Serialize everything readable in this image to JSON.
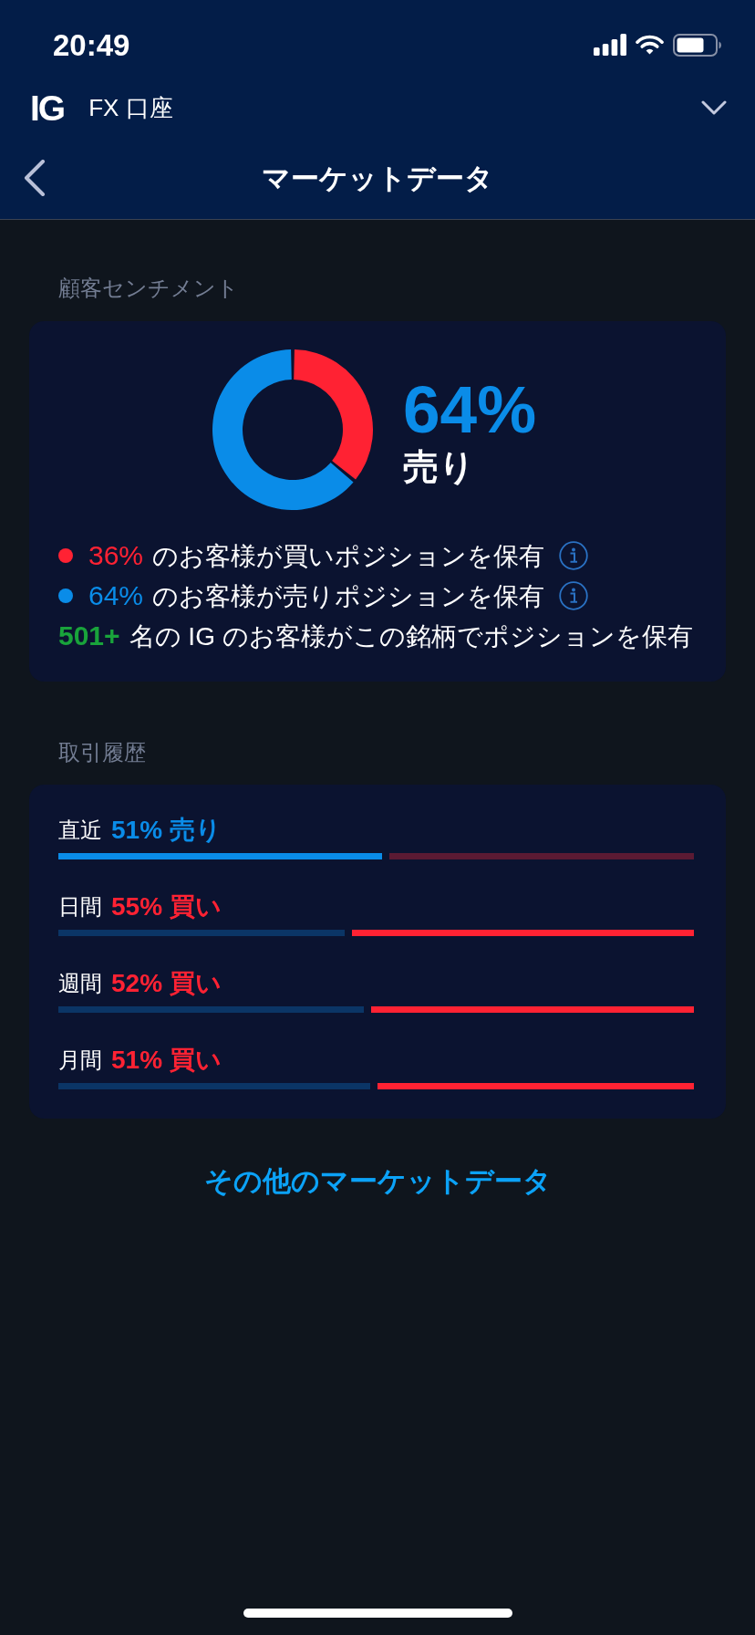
{
  "status_bar": {
    "time": "20:49"
  },
  "account_bar": {
    "logo": "IG",
    "account": "FX 口座"
  },
  "nav_bar": {
    "title": "マーケットデータ"
  },
  "sentiment": {
    "label": "顧客センチメント",
    "chart_data": {
      "type": "donut",
      "values": [
        36,
        64
      ]
    },
    "headline": {
      "value": "64%",
      "side": "売り",
      "kind": "sell"
    },
    "legend": [
      {
        "kind": "share",
        "color": "#ff2233",
        "percent": "36%",
        "text": "のお客様が買いポジションを保有"
      },
      {
        "kind": "share",
        "color": "#0a8ce8",
        "percent": "64%",
        "text": "のお客様が売りポジションを保有"
      },
      {
        "kind": "count",
        "count": "501+",
        "text": "名の IG のお客様がこの銘柄でポジションを保有"
      }
    ]
  },
  "history": {
    "label": "取引履歴",
    "rows": [
      {
        "period": "直近",
        "reading": "51% 売り",
        "kind": "sell",
        "level": 0.51
      },
      {
        "period": "日間",
        "reading": "55% 買い",
        "kind": "buy",
        "level": 0.45
      },
      {
        "period": "週間",
        "reading": "52% 買い",
        "kind": "buy",
        "level": 0.48
      },
      {
        "period": "月間",
        "reading": "51% 買い",
        "kind": "buy",
        "level": 0.49
      }
    ]
  },
  "more_link": "その他のマーケットデータ"
}
